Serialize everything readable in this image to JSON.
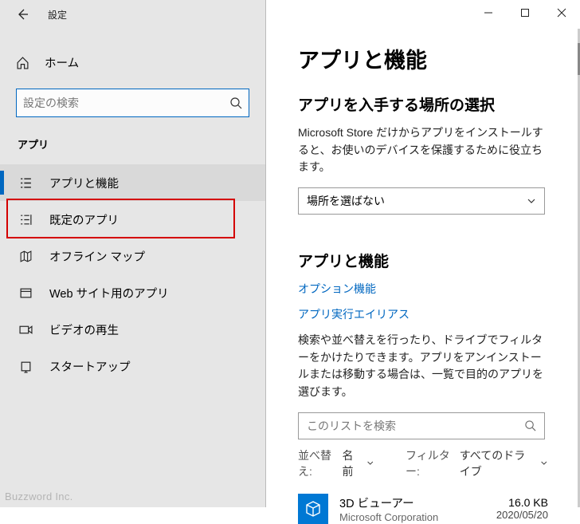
{
  "titlebar": {
    "label": "設定"
  },
  "home_label": "ホーム",
  "search": {
    "placeholder": "設定の検索"
  },
  "section_label": "アプリ",
  "nav": [
    {
      "id": "apps-features",
      "label": "アプリと機能",
      "selected": true
    },
    {
      "id": "default-apps",
      "label": "既定のアプリ"
    },
    {
      "id": "offline-maps",
      "label": "オフライン マップ"
    },
    {
      "id": "websites-apps",
      "label": "Web サイト用のアプリ"
    },
    {
      "id": "video-playback",
      "label": "ビデオの再生"
    },
    {
      "id": "startup",
      "label": "スタートアップ"
    }
  ],
  "page": {
    "title": "アプリと機能",
    "source": {
      "heading": "アプリを入手する場所の選択",
      "desc": "Microsoft Store だけからアプリをインストールすると、お使いのデバイスを保護するために役立ちます。",
      "dropdown_value": "場所を選ばない"
    },
    "section2_heading": "アプリと機能",
    "links": {
      "optional": "オプション機能",
      "alias": "アプリ実行エイリアス"
    },
    "desc2": "検索や並べ替えを行ったり、ドライブでフィルターをかけたりできます。アプリをアンインストールまたは移動する場合は、一覧で目的のアプリを選びます。",
    "searchlist_placeholder": "このリストを検索",
    "sort_label": "並べ替え:",
    "sort_value": "名前",
    "filter_label": "フィルター:",
    "filter_value": "すべてのドライブ",
    "app": {
      "name": "3D ビューアー",
      "publisher": "Microsoft Corporation",
      "size": "16.0 KB",
      "date": "2020/05/20"
    }
  },
  "watermark": "Buzzword Inc."
}
